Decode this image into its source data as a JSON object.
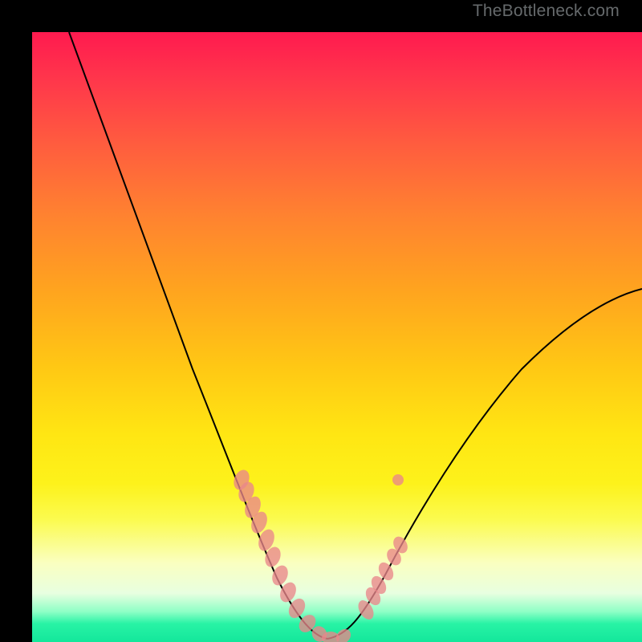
{
  "watermark": "TheBottleneck.com",
  "colors": {
    "frame": "#000000",
    "curve": "#000000",
    "dot": "#e9878b"
  },
  "chart_data": {
    "type": "line",
    "title": "",
    "xlabel": "",
    "ylabel": "",
    "xlim": [
      0,
      100
    ],
    "ylim": [
      0,
      100
    ],
    "note": "V-shaped curve with min near x≈48; y represents bottleneck % (0 at bottom). Pink segments mark bands on each arm near the valley.",
    "series": [
      {
        "name": "left-arm",
        "x": [
          6,
          10,
          15,
          20,
          25,
          30,
          34,
          38,
          41,
          44,
          46,
          48
        ],
        "y": [
          100,
          89,
          75,
          61,
          48,
          35,
          25,
          17,
          11,
          6,
          2.5,
          0.5
        ]
      },
      {
        "name": "right-arm",
        "x": [
          48,
          52,
          56,
          60,
          66,
          74,
          84,
          94,
          100
        ],
        "y": [
          0.5,
          2,
          6,
          12,
          21,
          32,
          43,
          51,
          55
        ]
      }
    ],
    "highlight_bands": {
      "left": {
        "x_range": [
          33,
          48
        ],
        "y_range": [
          0.5,
          27
        ]
      },
      "right": {
        "x_range": [
          52,
          60
        ],
        "y_range": [
          2,
          14
        ]
      }
    }
  }
}
